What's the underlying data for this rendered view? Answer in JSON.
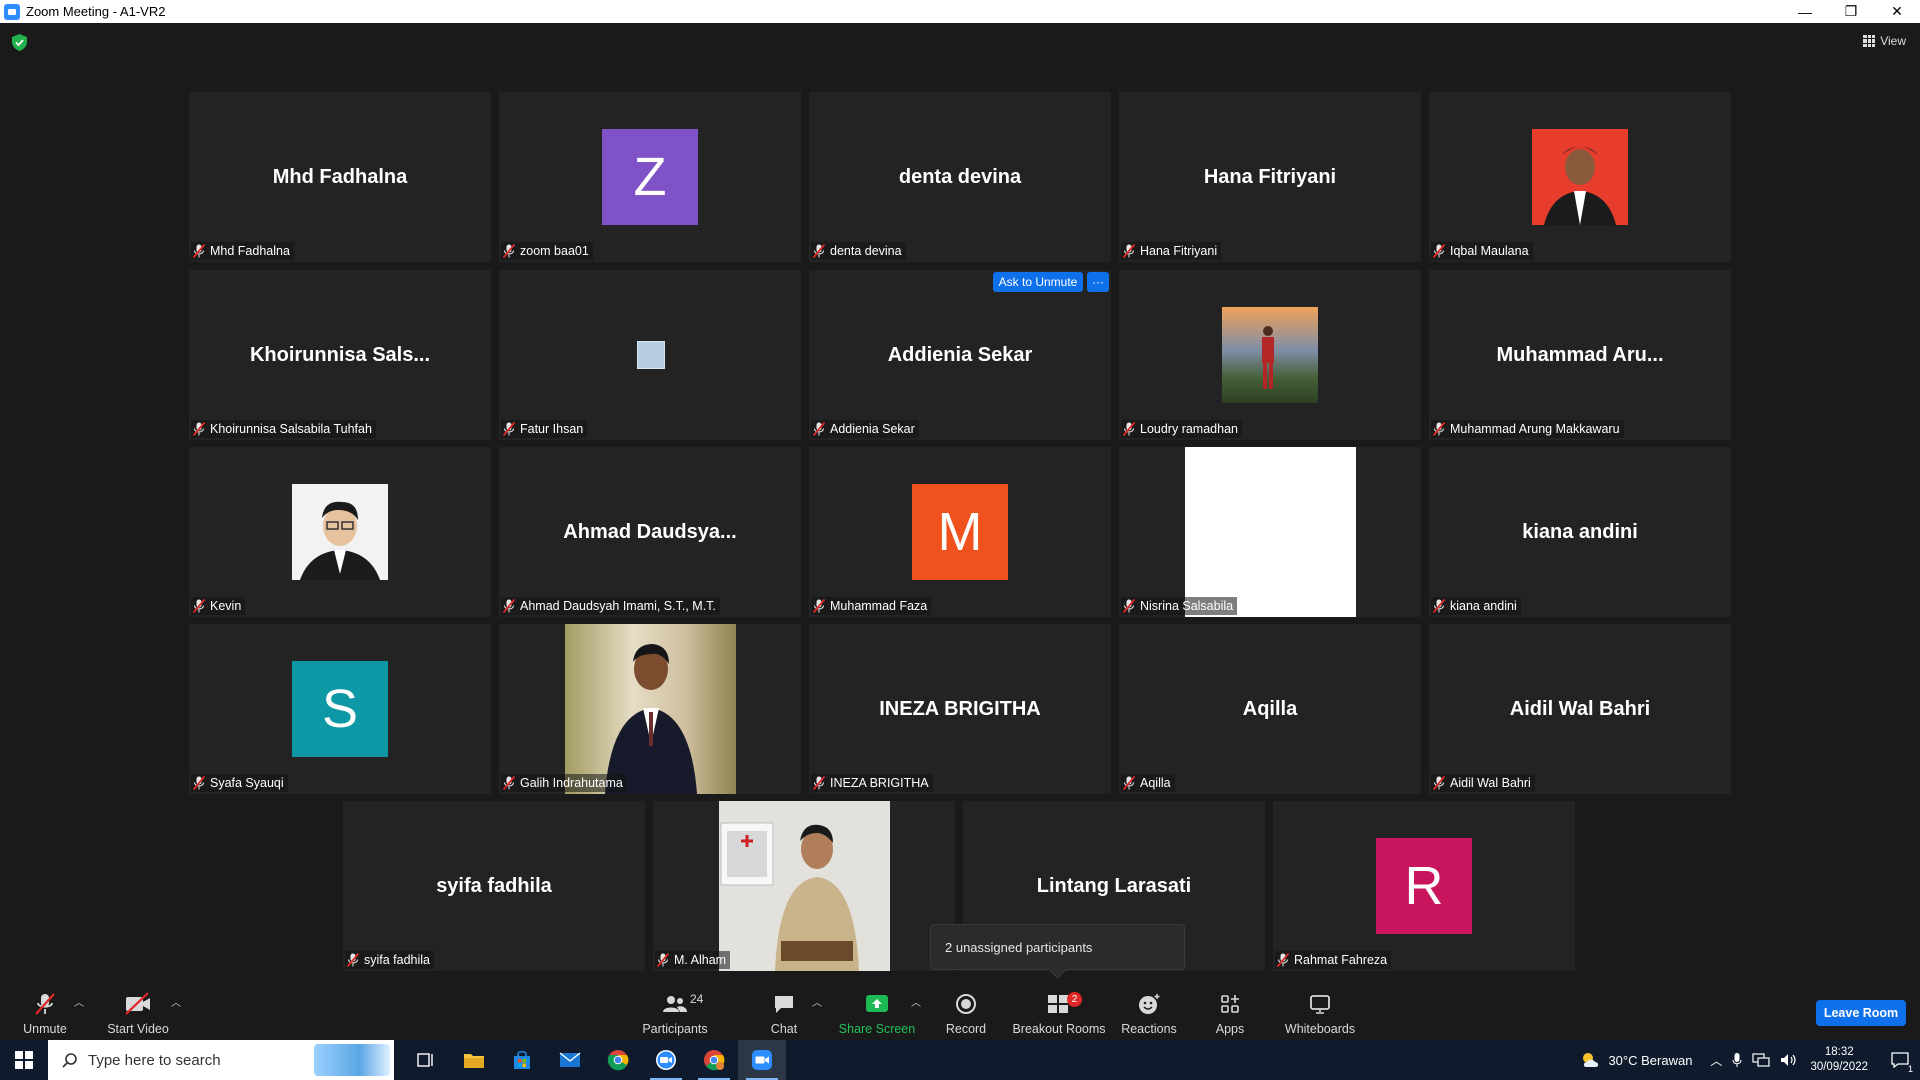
{
  "window": {
    "title": "Zoom Meeting - A1-VR2",
    "minimize": "—",
    "restore": "❐",
    "close": "✕"
  },
  "top_bar": {
    "view_label": "View"
  },
  "ask_to_unmute": {
    "label": "Ask to Unmute",
    "more": "···"
  },
  "tiles": [
    {
      "display": "Mhd Fadhalna",
      "name": "Mhd Fadhalna",
      "kind": "text"
    },
    {
      "display": "Z",
      "name": "zoom baa01",
      "kind": "letter",
      "color": "#7f52c8"
    },
    {
      "display": "denta devina",
      "name": "denta devina",
      "kind": "text"
    },
    {
      "display": "Hana Fitriyani",
      "name": "Hana Fitriyani",
      "kind": "text"
    },
    {
      "display": "",
      "name": "Iqbal Maulana",
      "kind": "photo"
    },
    {
      "display": "Khoirunnisa  Sals...",
      "name": "Khoirunnisa Salsabila Tuhfah",
      "kind": "text"
    },
    {
      "display": "",
      "name": "Fatur Ihsan",
      "kind": "photo"
    },
    {
      "display": "Addienia Sekar",
      "name": "Addienia Sekar",
      "kind": "text"
    },
    {
      "display": "",
      "name": "Loudry ramadhan",
      "kind": "photo"
    },
    {
      "display": "Muhammad  Aru...",
      "name": "Muhammad Arung Makkawaru",
      "kind": "text"
    },
    {
      "display": "",
      "name": "Kevin",
      "kind": "photo"
    },
    {
      "display": "Ahmad  Daudsya...",
      "name": "Ahmad Daudsyah Imami, S.T., M.T.",
      "kind": "text"
    },
    {
      "display": "M",
      "name": "Muhammad Faza",
      "kind": "letter",
      "color": "#f0521d"
    },
    {
      "display": "",
      "name": "Nisrina Salsabila",
      "kind": "photo"
    },
    {
      "display": "kiana andini",
      "name": "kiana andini",
      "kind": "text"
    },
    {
      "display": "S",
      "name": "Syafa Syauqi",
      "kind": "letter",
      "color": "#0e97a5"
    },
    {
      "display": "",
      "name": "Galih Indrahutama",
      "kind": "photo"
    },
    {
      "display": "INEZA BRIGITHA",
      "name": "INEZA BRIGITHA",
      "kind": "text"
    },
    {
      "display": "Aqilla",
      "name": "Aqilla",
      "kind": "text"
    },
    {
      "display": "Aidil Wal Bahri",
      "name": "Aidil Wal Bahri",
      "kind": "text"
    },
    {
      "display": "syifa fadhila",
      "name": "syifa fadhila",
      "kind": "text"
    },
    {
      "display": "",
      "name": "M. Alham",
      "kind": "photo"
    },
    {
      "display": "Lintang Larasati",
      "name": "Lintang Larasati",
      "kind": "text"
    },
    {
      "display": "R",
      "name": "Rahmat Fahreza",
      "kind": "letter",
      "color": "#c8155e"
    }
  ],
  "tooltip": {
    "unassigned": "2 unassigned participants"
  },
  "toolbar": {
    "unmute": "Unmute",
    "start_video": "Start Video",
    "participants": "Participants",
    "participants_count": "24",
    "chat": "Chat",
    "share_screen": "Share Screen",
    "record": "Record",
    "breakout_rooms": "Breakout Rooms",
    "breakout_badge": "2",
    "reactions": "Reactions",
    "apps": "Apps",
    "whiteboards": "Whiteboards",
    "leave": "Leave Room"
  },
  "taskbar": {
    "search_placeholder": "Type here to search",
    "weather": "30°C  Berawan",
    "time": "18:32",
    "date": "30/09/2022",
    "notif_count": "1"
  },
  "colors": {
    "accent_blue": "#0e71eb",
    "share_green": "#1db954",
    "mute_red": "#e02828"
  }
}
